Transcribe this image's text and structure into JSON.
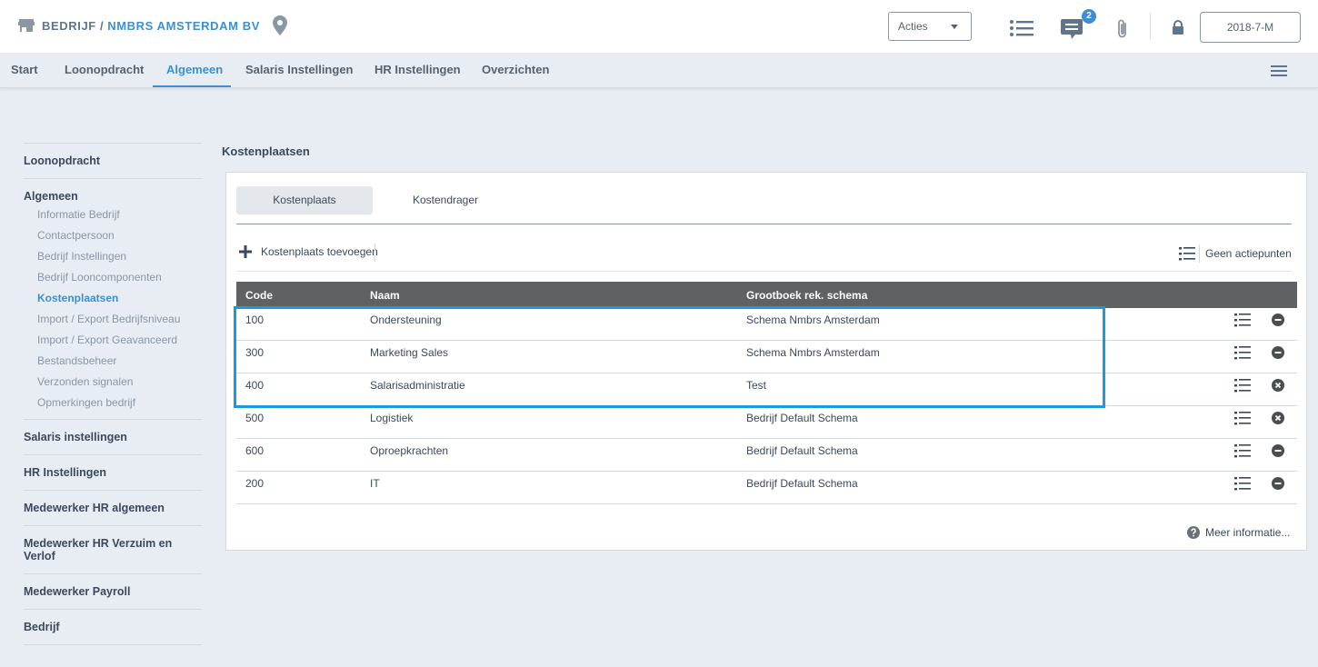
{
  "header": {
    "breadcrumb_root": "BEDRIJF /",
    "company": "NMBRS AMSTERDAM BV",
    "actions_label": "Acties",
    "messages_badge": "2",
    "period": "2018-7-M"
  },
  "tabs": [
    {
      "label": "Start"
    },
    {
      "label": "Loonopdracht"
    },
    {
      "label": "Algemeen"
    },
    {
      "label": "Salaris Instellingen"
    },
    {
      "label": "HR Instellingen"
    },
    {
      "label": "Overzichten"
    }
  ],
  "sidebar": {
    "loonopdracht": "Loonopdracht",
    "algemeen": "Algemeen",
    "algemeen_items": [
      {
        "label": "Informatie Bedrijf"
      },
      {
        "label": "Contactpersoon"
      },
      {
        "label": "Bedrijf Instellingen"
      },
      {
        "label": "Bedrijf Looncomponenten"
      },
      {
        "label": "Kostenplaatsen"
      },
      {
        "label": "Import / Export Bedrijfsniveau"
      },
      {
        "label": "Import / Export Geavanceerd"
      },
      {
        "label": "Bestandsbeheer"
      },
      {
        "label": "Verzonden signalen"
      },
      {
        "label": "Opmerkingen bedrijf"
      }
    ],
    "groups": [
      {
        "label": "Salaris instellingen"
      },
      {
        "label": "HR Instellingen"
      },
      {
        "label": "Medewerker HR algemeen"
      },
      {
        "label": "Medewerker HR Verzuim en Verlof"
      },
      {
        "label": "Medewerker Payroll"
      },
      {
        "label": "Bedrijf"
      }
    ]
  },
  "main": {
    "title": "Kostenplaatsen",
    "subtabs": [
      {
        "label": "Kostenplaats"
      },
      {
        "label": "Kostendrager"
      }
    ],
    "add_label": "Kostenplaats toevoegen",
    "actions_label": "Geen actiepunten",
    "columns": {
      "code": "Code",
      "naam": "Naam",
      "schema": "Grootboek rek. schema"
    },
    "rows": [
      {
        "code": "100",
        "naam": "Ondersteuning",
        "schema": "Schema Nmbrs Amsterdam",
        "action": "minus-circle-icon"
      },
      {
        "code": "300",
        "naam": "Marketing Sales",
        "schema": "Schema Nmbrs Amsterdam",
        "action": "minus-circle-icon"
      },
      {
        "code": "400",
        "naam": "Salarisadministratie",
        "schema": "Test",
        "action": "x-circle-icon"
      },
      {
        "code": "500",
        "naam": "Logistiek",
        "schema": "Bedrijf Default Schema",
        "action": "x-circle-icon"
      },
      {
        "code": "600",
        "naam": "Oproepkrachten",
        "schema": "Bedrijf Default Schema",
        "action": "minus-circle-icon"
      },
      {
        "code": "200",
        "naam": "IT",
        "schema": "Bedrijf Default Schema",
        "action": "minus-circle-icon"
      }
    ],
    "more_info": "Meer informatie..."
  },
  "colors": {
    "accent": "#3d8fd1",
    "highlight": "#1b9ae0",
    "table_header": "#5f6163"
  }
}
